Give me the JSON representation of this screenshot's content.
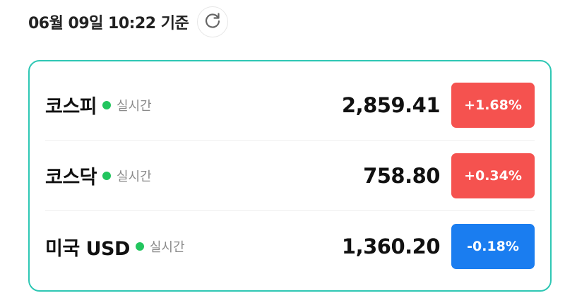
{
  "header": {
    "timestamp": "06월 09일 10:22 기준",
    "refresh_icon": "refresh-icon"
  },
  "colors": {
    "accent_border": "#2ec7b4",
    "live_dot": "#22c55e",
    "up_badge": "#f5524f",
    "down_badge": "#1a7df0"
  },
  "markets": [
    {
      "name": "코스피",
      "status": "실시간",
      "value": "2,859.41",
      "change": "+1.68%",
      "direction": "up"
    },
    {
      "name": "코스닥",
      "status": "실시간",
      "value": "758.80",
      "change": "+0.34%",
      "direction": "up"
    },
    {
      "name": "미국 USD",
      "status": "실시간",
      "value": "1,360.20",
      "change": "-0.18%",
      "direction": "down"
    }
  ]
}
